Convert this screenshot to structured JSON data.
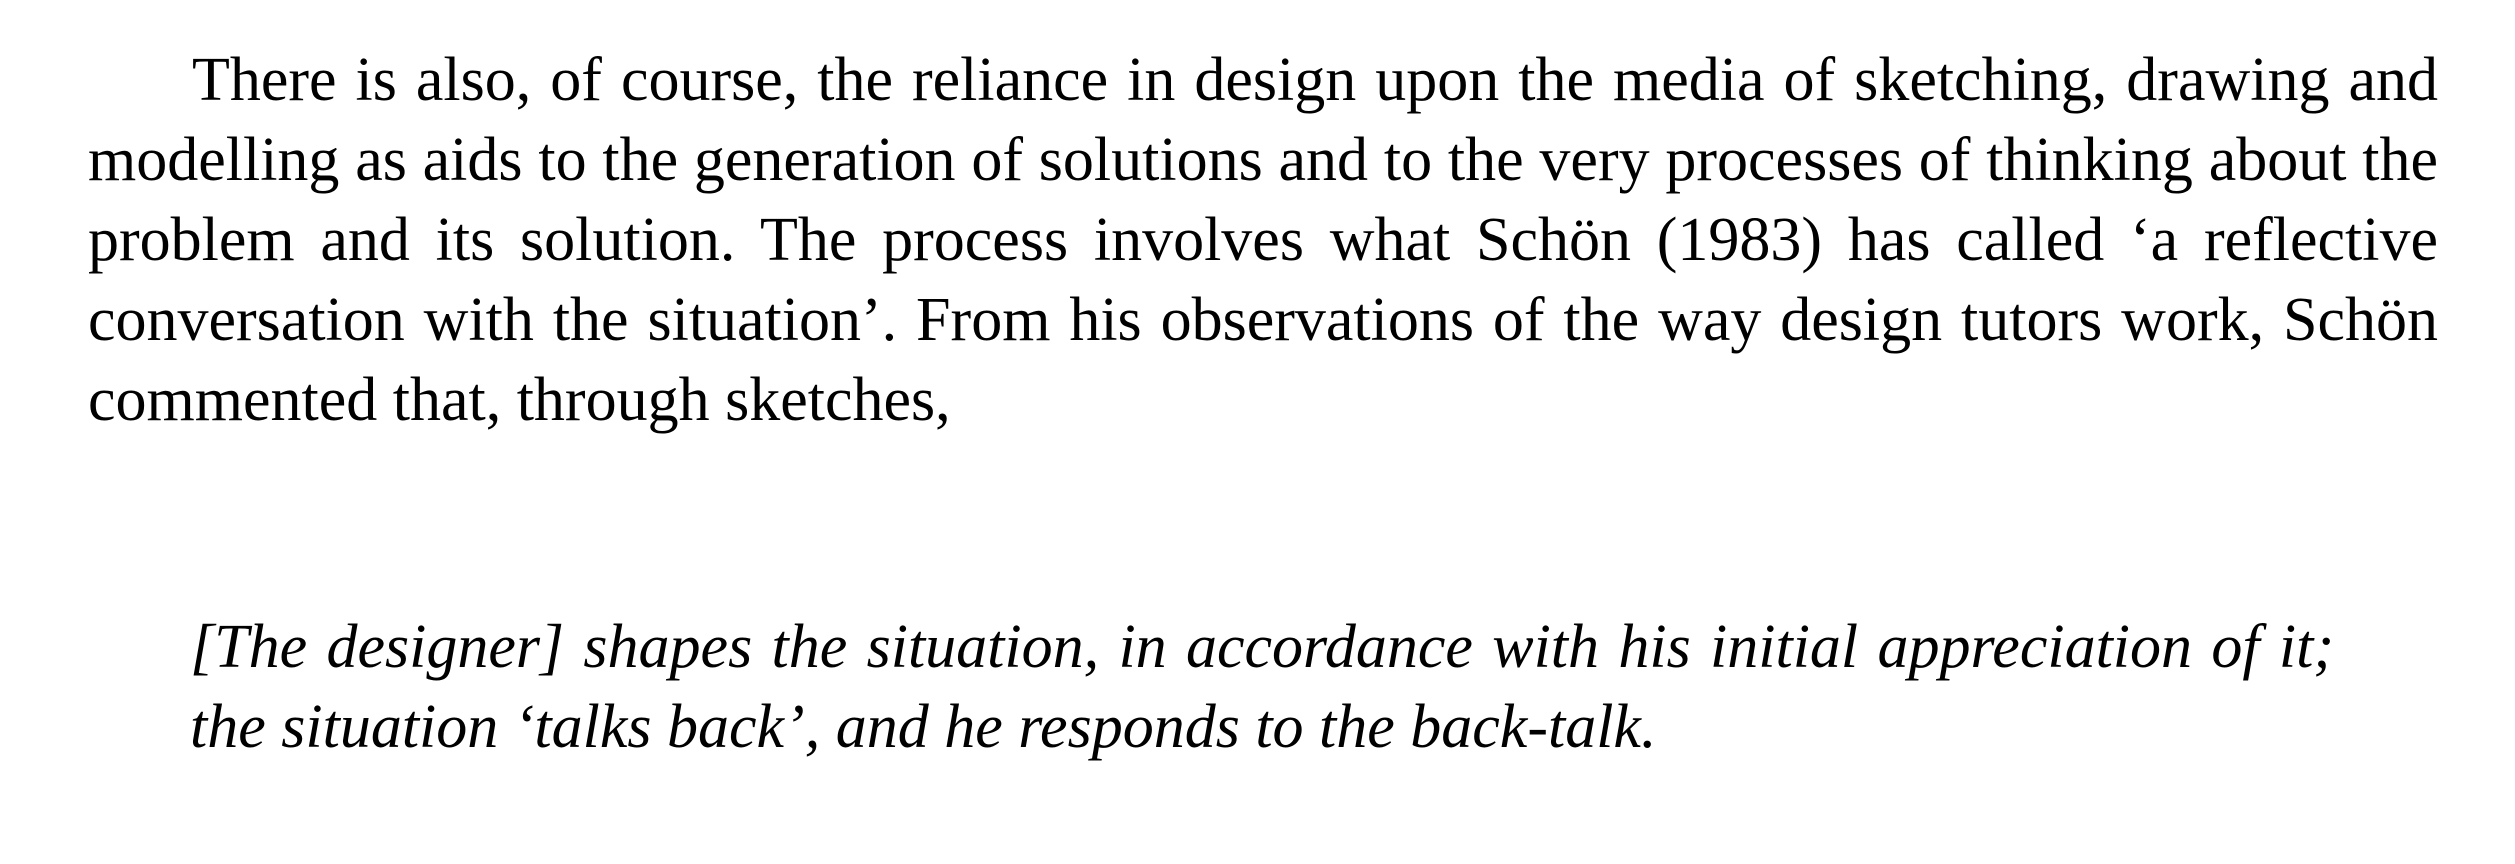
{
  "document": {
    "paragraph": "There is also, of course, the reliance in design upon the media of sketching, drawing and modelling as aids to the generation of solutions and to the very processes of thinking about the problem and its solution. The process involves what Schön (1983) has called ‘a reflective conversation with the situation’. From his observations of the way design tutors work, Schön commented that, through sketches,",
    "quote": "[The designer] shapes the situation, in accordance with his initial appreciation of it; the situation ‘talks back’, and he responds to the back-talk."
  }
}
